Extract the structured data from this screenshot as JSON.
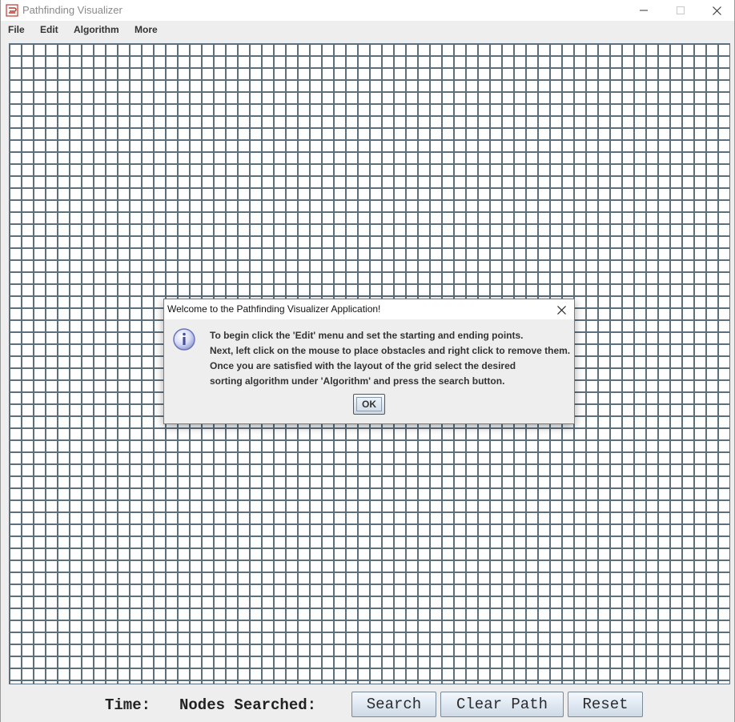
{
  "window": {
    "title": "Pathfinding Visualizer"
  },
  "menu": {
    "items": [
      {
        "label": "File"
      },
      {
        "label": "Edit"
      },
      {
        "label": "Algorithm"
      },
      {
        "label": "More"
      }
    ]
  },
  "grid": {
    "cell_color": "#ffffff",
    "line_color": "#5c6f7c"
  },
  "status": {
    "time_label": "Time:",
    "nodes_label": "Nodes Searched:"
  },
  "buttons": {
    "search": "Search",
    "clear_path": "Clear Path",
    "reset": "Reset"
  },
  "dialog": {
    "title": "Welcome to the Pathfinding Visualizer Application!",
    "icon": "info-icon",
    "lines": [
      "To begin click the 'Edit' menu and set the starting and ending points.",
      "Next, left click on the mouse to place obstacles and right click to remove them.",
      "Once you are satisfied with the layout of the grid select the desired",
      "sorting algorithm under 'Algorithm' and press the search button."
    ],
    "ok_label": "OK"
  }
}
